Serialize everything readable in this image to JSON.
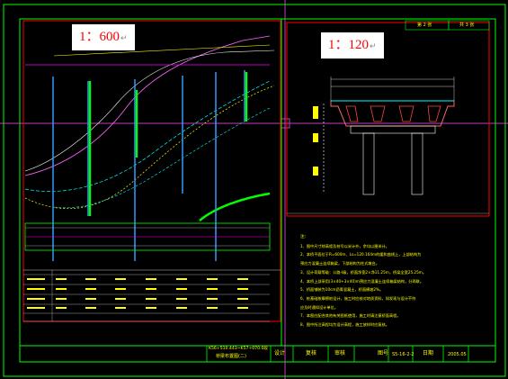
{
  "viewport": {
    "scale_left": "1：600",
    "scale_right": "1：120",
    "return_mark": "↵"
  },
  "title_block": {
    "drawing_name_line1": "K56+510.443~K57+070.0段",
    "drawing_name_line2": "桥梁布置图(二)",
    "designer_label": "设计",
    "reviewer_label": "复核",
    "approver_label": "审核",
    "drawing_no_label": "图号",
    "drawing_no": "S5-16-2-2",
    "date_label": "日期",
    "date": "2005.05"
  },
  "page_marks": {
    "sheet_label": "第 2 张",
    "total_label": "共 3 张"
  },
  "notes": {
    "title": "注：",
    "items": [
      "1、图中尺寸除高程及桩号以米计外，余均以厘米计。",
      "2、本桥平面位于R=600m、Ls=120.164m的缓和曲线上，上部结构为",
      "   预应力混凝土连续箱梁，下部结构为柱式墩台。",
      "3、设计荷载等级：公路-I级，桥面净宽2×净11.25m，桥梁全宽25.25m。",
      "4、本桥上部采用(3×40+3×40)m预应力混凝土连续箱梁结构，分两联。",
      "5、桥面铺装为10cm沥青混凝土，桥面横坡2%。",
      "6、桩基础按摩擦桩设计，施工时应核对地质资料，如发现与设计不符",
      "   应及时通知设计单位。",
      "7、本图应配合其他有关图纸使用，施工时请注意桥面高程。",
      "8、图中所注高程均为设计高程，施工放样时应复核。"
    ]
  }
}
